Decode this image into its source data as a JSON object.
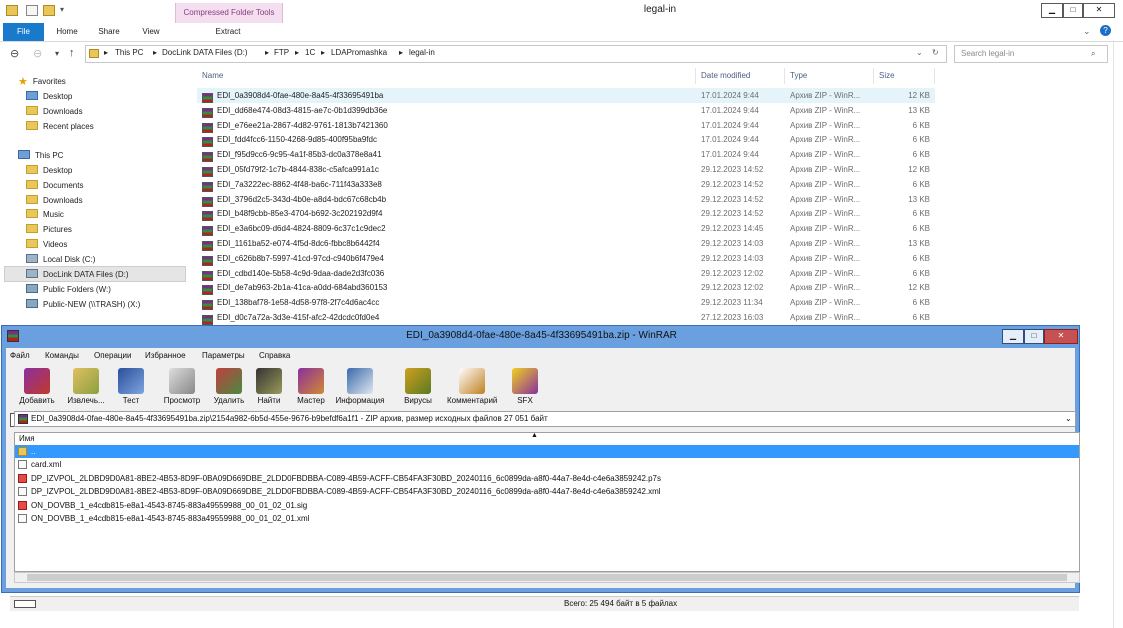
{
  "explorer": {
    "title": "legal-in",
    "tool_tab": "Compressed Folder Tools",
    "ribbon_tabs": [
      "File",
      "Home",
      "Share",
      "View",
      "Extract"
    ],
    "address": [
      "This PC",
      "DocLink DATA Files (D:)",
      "FTP",
      "1C",
      "LDAPromashka",
      "legal-in"
    ],
    "search_placeholder": "Search legal-in",
    "columns": {
      "name": "Name",
      "date": "Date modified",
      "type": "Type",
      "size": "Size"
    },
    "nav": {
      "favorites": "Favorites",
      "fav_items": [
        "Desktop",
        "Downloads",
        "Recent places"
      ],
      "this_pc": "This PC",
      "pc_items": [
        "Desktop",
        "Documents",
        "Downloads",
        "Music",
        "Pictures",
        "Videos",
        "Local Disk (C:)",
        "DocLink DATA Files (D:)",
        "Public Folders (W:)",
        "Public-NEW (\\\\TRASH) (X:)"
      ]
    },
    "files": [
      {
        "name": "EDI_0a3908d4-0fae-480e-8a45-4f33695491ba",
        "date": "17.01.2024 9:44",
        "type": "Архив ZIP - WinR...",
        "size": "12 KB"
      },
      {
        "name": "EDI_dd68e474-08d3-4815-ae7c-0b1d399db36e",
        "date": "17.01.2024 9:44",
        "type": "Архив ZIP - WinR...",
        "size": "13 KB"
      },
      {
        "name": "EDI_e76ee21a-2867-4d82-9761-1813b7421360",
        "date": "17.01.2024 9:44",
        "type": "Архив ZIP - WinR...",
        "size": "6 KB"
      },
      {
        "name": "EDI_fdd4fcc6-1150-4268-9d85-400f95ba9fdc",
        "date": "17.01.2024 9:44",
        "type": "Архив ZIP - WinR...",
        "size": "6 KB"
      },
      {
        "name": "EDI_f95d9cc6-9c95-4a1f-85b3-dc0a378e8a41",
        "date": "17.01.2024 9:44",
        "type": "Архив ZIP - WinR...",
        "size": "6 KB"
      },
      {
        "name": "EDI_05fd79f2-1c7b-4844-838c-c5afca991a1c",
        "date": "29.12.2023 14:52",
        "type": "Архив ZIP - WinR...",
        "size": "12 KB"
      },
      {
        "name": "EDI_7a3222ec-8862-4f48-ba6c-711f43a333e8",
        "date": "29.12.2023 14:52",
        "type": "Архив ZIP - WinR...",
        "size": "6 KB"
      },
      {
        "name": "EDI_3796d2c5-343d-4b0e-a8d4-bdc67c68cb4b",
        "date": "29.12.2023 14:52",
        "type": "Архив ZIP - WinR...",
        "size": "13 KB"
      },
      {
        "name": "EDI_b48f9cbb-85e3-4704-b692-3c202192d9f4",
        "date": "29.12.2023 14:52",
        "type": "Архив ZIP - WinR...",
        "size": "6 KB"
      },
      {
        "name": "EDI_e3a6bc09-d6d4-4824-8809-6c37c1c9dec2",
        "date": "29.12.2023 14:45",
        "type": "Архив ZIP - WinR...",
        "size": "6 KB"
      },
      {
        "name": "EDI_1161ba52-e074-4f5d-8dc6-fbbc8b6442f4",
        "date": "29.12.2023 14:03",
        "type": "Архив ZIP - WinR...",
        "size": "13 KB"
      },
      {
        "name": "EDI_c626b8b7-5997-41cd-97cd-c940b6f479e4",
        "date": "29.12.2023 14:03",
        "type": "Архив ZIP - WinR...",
        "size": "6 KB"
      },
      {
        "name": "EDI_cdbd140e-5b58-4c9d-9daa-dade2d3fc036",
        "date": "29.12.2023 12:02",
        "type": "Архив ZIP - WinR...",
        "size": "6 KB"
      },
      {
        "name": "EDI_de7ab963-2b1a-41ca-a0dd-684abd360153",
        "date": "29.12.2023 12:02",
        "type": "Архив ZIP - WinR...",
        "size": "12 KB"
      },
      {
        "name": "EDI_138baf78-1e58-4d58-97f8-2f7c4d6ac4cc",
        "date": "29.12.2023 11:34",
        "type": "Архив ZIP - WinR...",
        "size": "6 KB"
      },
      {
        "name": "EDI_d0c7a72a-3d3e-415f-afc2-42dcdc0fd0e4",
        "date": "27.12.2023 16:03",
        "type": "Архив ZIP - WinR...",
        "size": "6 KB"
      }
    ]
  },
  "winrar": {
    "title": "EDI_0a3908d4-0fae-480e-8a45-4f33695491ba.zip - WinRAR",
    "menu": [
      "Файл",
      "Команды",
      "Операции",
      "Избранное",
      "Параметры",
      "Справка"
    ],
    "tools": [
      "Добавить",
      "Извлечь...",
      "Тест",
      "Просмотр",
      "Удалить",
      "Найти",
      "Мастер",
      "Информация",
      "Вирусы",
      "Комментарий",
      "SFX"
    ],
    "path": "EDI_0a3908d4-0fae-480e-8a45-4f33695491ba.zip\\2154a982-6b5d-455e-9676-b9befdf6a1f1 - ZIP архив, размер исходных файлов 27 051 байт",
    "column_name": "Имя",
    "up_entry": "..",
    "entries": [
      "card.xml",
      "DP_IZVPOL_2LDBD9D0A81-8BE2-4B53-8D9F-0BA09D669DBE_2LDD0FBDBBA-C089-4B59-ACFF-CB54FA3F30BD_20240116_6c0899da-a8f0-44a7-8e4d-c4e6a3859242.p7s",
      "DP_IZVPOL_2LDBD9D0A81-8BE2-4B53-8D9F-0BA09D669DBE_2LDD0FBDBBA-C089-4B59-ACFF-CB54FA3F30BD_20240116_6c0899da-a8f0-44a7-8e4d-c4e6a3859242.xml",
      "ON_DOVBB_1_e4cdb815-e8a1-4543-8745-883a49559988_00_01_02_01.sig",
      "ON_DOVBB_1_e4cdb815-e8a1-4543-8745-883a49559988_00_01_02_01.xml"
    ],
    "status": "Всего: 25 494 байт в 5 файлах"
  }
}
